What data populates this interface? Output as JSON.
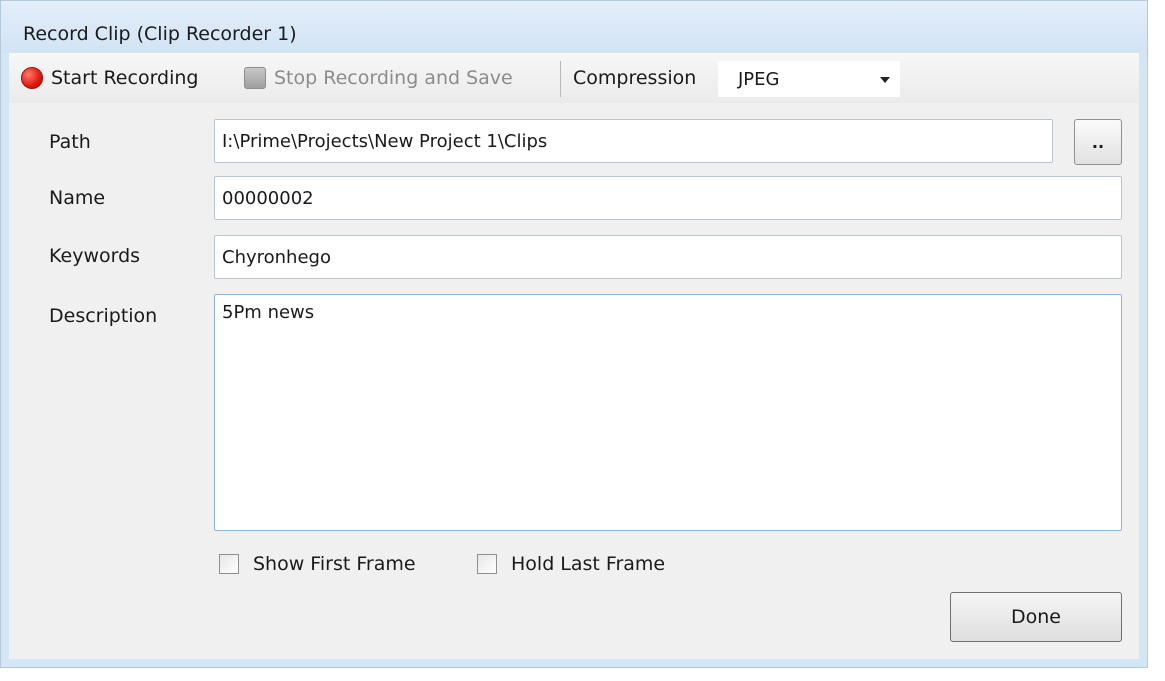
{
  "window": {
    "title": "Record Clip (Clip Recorder 1)"
  },
  "toolbar": {
    "start_label": "Start Recording",
    "stop_label": "Stop Recording and Save",
    "compression_label": "Compression",
    "compression_value": "JPEG"
  },
  "form": {
    "path_label": "Path",
    "path_value": "I:\\Prime\\Projects\\New Project 1\\Clips",
    "browse_label": "..",
    "name_label": "Name",
    "name_value": "00000002",
    "keywords_label": "Keywords",
    "keywords_value": "Chyronhego",
    "description_label": "Description",
    "description_value": "5Pm news"
  },
  "options": {
    "show_first_frame_label": "Show First Frame",
    "show_first_frame_checked": false,
    "hold_last_frame_label": "Hold Last Frame",
    "hold_last_frame_checked": false
  },
  "actions": {
    "done_label": "Done"
  },
  "icons": {
    "start": "record-icon",
    "stop": "stop-icon",
    "dropdown": "chevron-down-icon"
  },
  "colors": {
    "record_red": "#e01a10",
    "window_frame": "#d4e5f5",
    "panel_bg": "#f0f0f0"
  }
}
